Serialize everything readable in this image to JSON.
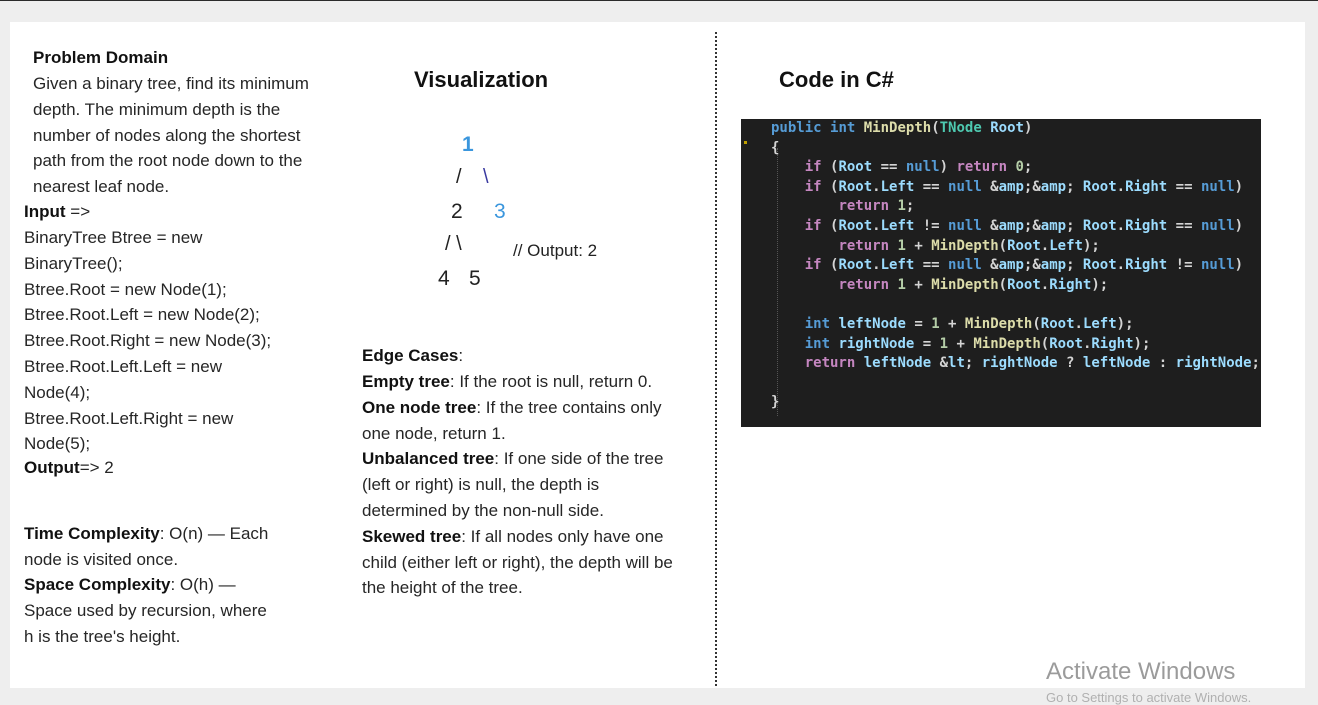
{
  "left": {
    "problem_title": "Problem Domain",
    "problem_lines": [
      "Given a binary tree, find its minimum",
      "depth. The minimum depth is the",
      "number of nodes along the shortest",
      "path from the root node down to the",
      "nearest leaf node."
    ],
    "input_label": "Input",
    "input_arrow": " =>",
    "input_lines": [
      "BinaryTree Btree = new",
      "BinaryTree();",
      "Btree.Root = new Node(1);",
      "Btree.Root.Left = new Node(2);",
      "Btree.Root.Right = new Node(3);",
      "Btree.Root.Left.Left = new",
      "Node(4);",
      "Btree.Root.Left.Right = new",
      "Node(5);"
    ],
    "output_label": "Output",
    "output_value": "=> 2",
    "time_label": "Time Complexity",
    "time_rest": ": O(n) — Each",
    "time_line2": "node is visited once.",
    "space_label": "Space Complexity",
    "space_rest": ": O(h) —",
    "space_line2": "Space used by recursion, where",
    "space_line3": "h is the tree's height."
  },
  "middle": {
    "visualization_title": "Visualization",
    "tree": {
      "n1": "1",
      "slash_left_1": "/",
      "slash_right_1": "\\",
      "n2": "2",
      "n3": "3",
      "slashes_2": "/ \\",
      "n4": "4",
      "n5": "5",
      "output_comment": "// Output: 2"
    },
    "edge_title": "Edge Cases",
    "edge_colon": ":",
    "edge_cases": [
      {
        "label": "Empty tree",
        "lines": [
          ": If the root is null, return 0."
        ]
      },
      {
        "label": "One node tree",
        "lines": [
          ": If the tree contains only",
          "one node, return 1."
        ]
      },
      {
        "label": "Unbalanced tree",
        "lines": [
          ": If one side of the tree",
          "(left or right) is null, the depth is",
          "determined by the non-null side."
        ]
      },
      {
        "label": "Skewed tree",
        "lines": [
          ": If all nodes only have one",
          "child (either left or right), the depth will be",
          "the height of the tree."
        ]
      }
    ]
  },
  "right": {
    "code_title": "Code in C#",
    "code_lines": [
      "public int MinDepth(TNode Root)",
      "{",
      "    if (Root == null) return 0;",
      "    if (Root.Left == null && Root.Right == null)",
      "        return 1;",
      "    if (Root.Left != null && Root.Right == null)",
      "        return 1 + MinDepth(Root.Left);",
      "    if (Root.Left == null && Root.Right != null)",
      "        return 1 + MinDepth(Root.Right);",
      "",
      "    int leftNode = 1 + MinDepth(Root.Left);",
      "    int rightNode = 1 + MinDepth(Root.Right);",
      "    return leftNode < rightNode ? leftNode : rightNode;",
      "",
      "}"
    ]
  },
  "watermark": {
    "title": "Activate Windows",
    "subtitle": "Go to Settings to activate Windows."
  }
}
